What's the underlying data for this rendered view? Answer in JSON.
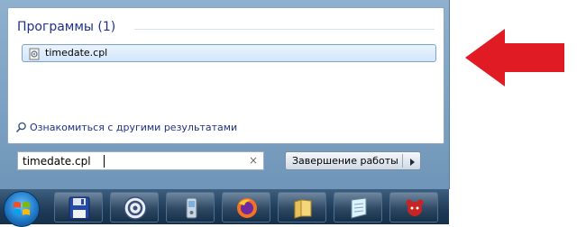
{
  "start_menu": {
    "group_header": "Программы (1)",
    "result_item": {
      "label": "timedate.cpl",
      "icon": "control-panel-file-icon"
    },
    "more_results_link": "Ознакомиться с другими результатами",
    "search": {
      "value": "timedate.cpl",
      "clear_icon": "×"
    },
    "shutdown": {
      "label": "Завершение работы",
      "arrow": "▸"
    }
  },
  "taskbar": {
    "items": [
      {
        "name": "floppy-save-icon"
      },
      {
        "name": "bittorrent-icon"
      },
      {
        "name": "phone-icon"
      },
      {
        "name": "firefox-icon"
      },
      {
        "name": "folder-icon"
      },
      {
        "name": "notepad-icon"
      },
      {
        "name": "game-app-icon"
      }
    ]
  },
  "annotation": {
    "arrow_color": "#e01b24"
  }
}
